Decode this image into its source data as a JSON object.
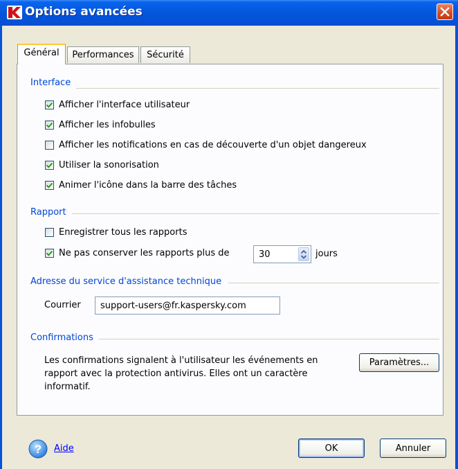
{
  "window": {
    "title": "Options avancées"
  },
  "tabs": [
    {
      "label": "Général",
      "active": true
    },
    {
      "label": "Performances",
      "active": false
    },
    {
      "label": "Sécurité",
      "active": false
    }
  ],
  "interface": {
    "header": "Interface",
    "options": [
      {
        "label": "Afficher l'interface utilisateur",
        "checked": true
      },
      {
        "label": "Afficher les infobulles",
        "checked": true
      },
      {
        "label": "Afficher les notifications en cas de découverte d'un objet dangereux",
        "checked": false
      },
      {
        "label": "Utiliser la sonorisation",
        "checked": true
      },
      {
        "label": "Animer l'icône dans la barre des tâches",
        "checked": true
      }
    ]
  },
  "report": {
    "header": "Rapport",
    "save_all": {
      "label": "Enregistrer tous les rapports",
      "checked": false
    },
    "keep_limit": {
      "label": "Ne pas conserver les rapports plus de",
      "checked": true,
      "value": "30",
      "unit": "jours"
    }
  },
  "support": {
    "header": "Adresse du service d'assistance technique",
    "mail_label": "Courrier",
    "mail_value": "support-users@fr.kaspersky.com"
  },
  "confirmations": {
    "header": "Confirmations",
    "text_lines": [
      "Les confirmations signalent à l'utilisateur les événements en",
      "rapport avec la protection antivirus. Elles ont un caractère",
      "informatif."
    ],
    "settings_button": "Paramètres..."
  },
  "footer": {
    "help": "Aide",
    "ok": "OK",
    "cancel": "Annuler"
  },
  "colors": {
    "titlebar": "#0458df",
    "accent_text": "#0046d5",
    "check": "#21a121",
    "face": "#ECE9D8"
  }
}
